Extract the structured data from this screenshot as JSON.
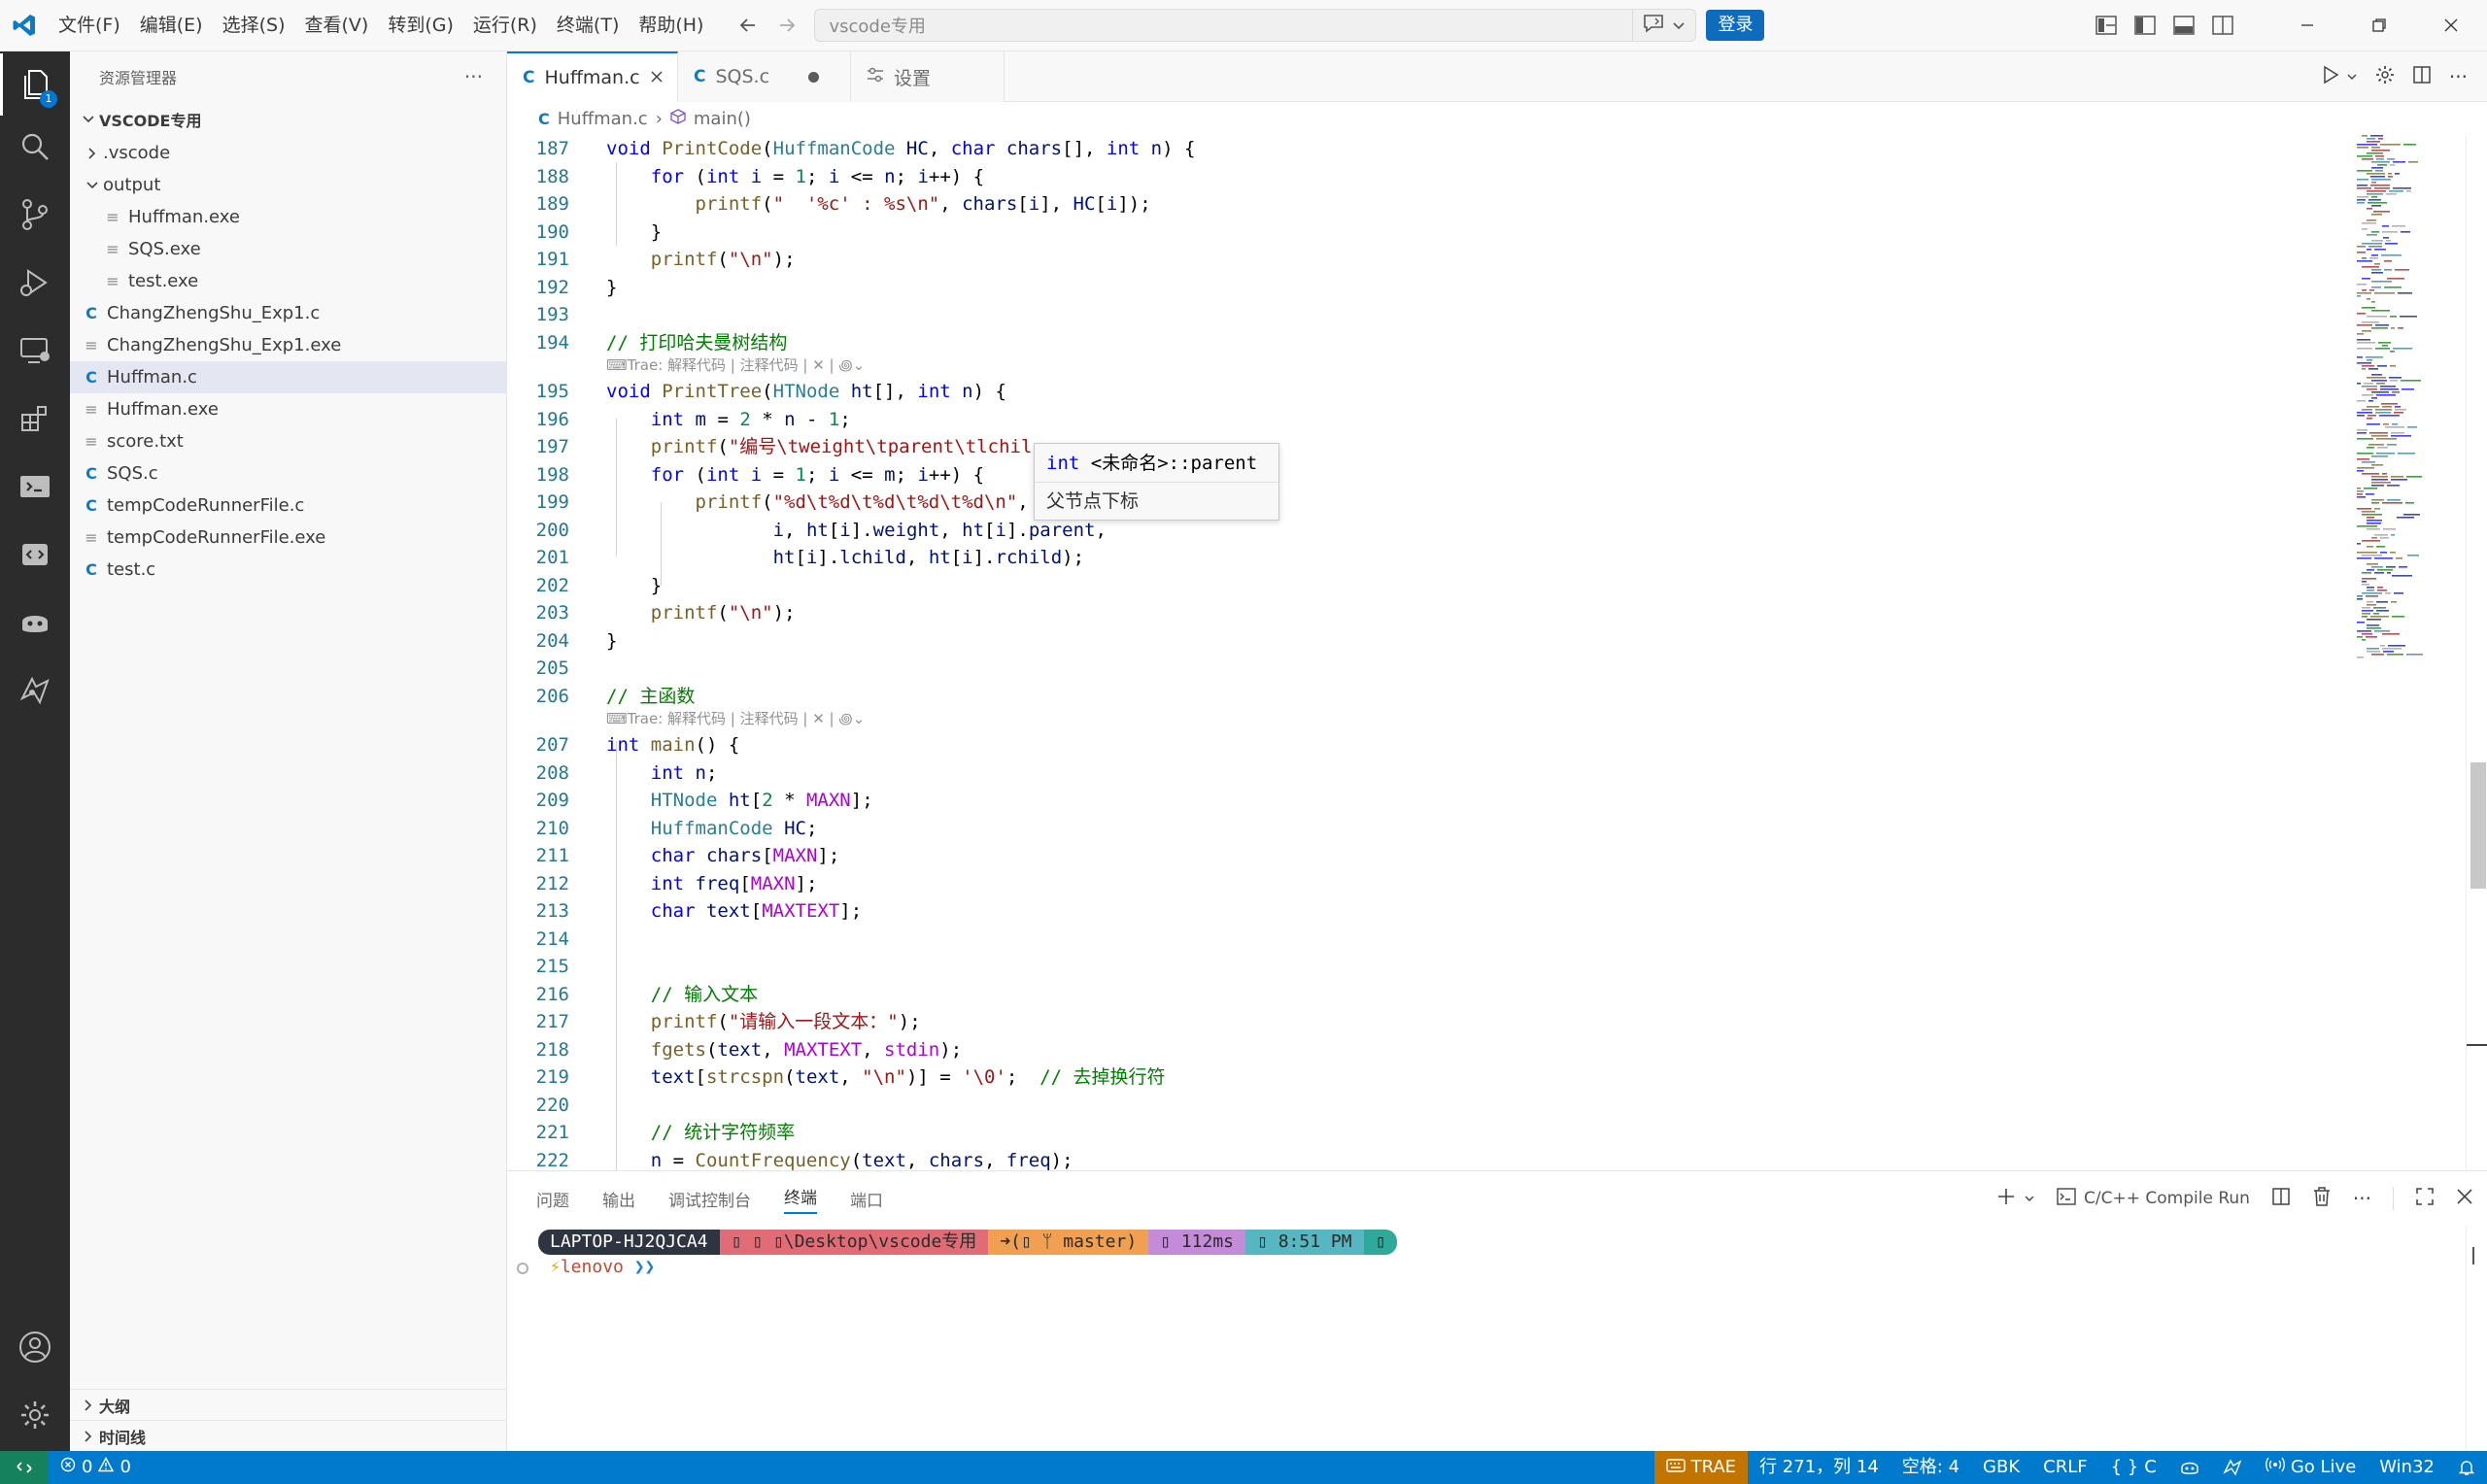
{
  "window": {
    "menu": [
      "文件(F)",
      "编辑(E)",
      "选择(S)",
      "查看(V)",
      "转到(G)",
      "运行(R)",
      "终端(T)",
      "帮助(H)"
    ],
    "search_placeholder": "vscode专用",
    "login_label": "登录"
  },
  "activity": {
    "explorer_badge": "1"
  },
  "sidebar": {
    "header": "资源管理器",
    "folder": "VSCODE专用",
    "items": [
      {
        "label": ".vscode",
        "kind": "folder-collapsed",
        "depth": 0
      },
      {
        "label": "output",
        "kind": "folder-open",
        "depth": 0
      },
      {
        "label": "Huffman.exe",
        "kind": "file",
        "depth": 1
      },
      {
        "label": "SQS.exe",
        "kind": "file",
        "depth": 1
      },
      {
        "label": "test.exe",
        "kind": "file",
        "depth": 1
      },
      {
        "label": "ChangZhengShu_Exp1.c",
        "kind": "c",
        "depth": 0
      },
      {
        "label": "ChangZhengShu_Exp1.exe",
        "kind": "file",
        "depth": 0
      },
      {
        "label": "Huffman.c",
        "kind": "c",
        "depth": 0,
        "selected": true
      },
      {
        "label": "Huffman.exe",
        "kind": "file",
        "depth": 0
      },
      {
        "label": "score.txt",
        "kind": "file",
        "depth": 0
      },
      {
        "label": "SQS.c",
        "kind": "c",
        "depth": 0
      },
      {
        "label": "tempCodeRunnerFile.c",
        "kind": "c",
        "depth": 0
      },
      {
        "label": "tempCodeRunnerFile.exe",
        "kind": "file",
        "depth": 0
      },
      {
        "label": "test.c",
        "kind": "c",
        "depth": 0
      }
    ],
    "outline_label": "大纲",
    "timeline_label": "时间线"
  },
  "tabs": [
    {
      "label": "Huffman.c",
      "icon": "C",
      "active": true
    },
    {
      "label": "SQS.c",
      "icon": "C",
      "modified": true
    },
    {
      "label": "设置",
      "icon": "settings"
    }
  ],
  "breadcrumb": {
    "file": "Huffman.c",
    "symbol": "main()"
  },
  "editor": {
    "codelens": "Trae: 解释代码 | 注释代码 | ✕ |",
    "hover": {
      "signature": "int <未命名>::parent",
      "doc": "父节点下标"
    },
    "lines": [
      {
        "n": "187",
        "html": "<span class='k'>void</span> <span class='f'>PrintCode</span>(<span class='t'>HuffmanCode</span> <span class='p'>HC</span>, <span class='k'>char</span> <span class='p'>chars</span>[], <span class='k'>int</span> <span class='p'>n</span>) {"
      },
      {
        "n": "188",
        "html": "    <span class='k'>for</span> (<span class='k'>int</span> <span class='p'>i</span> = <span class='m'>1</span>; <span class='p'>i</span> &lt;= <span class='p'>n</span>; <span class='p'>i</span>++) {"
      },
      {
        "n": "189",
        "html": "        <span class='f'>printf</span>(<span class='s'>\"  '%c' : %s\\n\"</span>, <span class='p'>chars</span>[<span class='p'>i</span>], <span class='p'>HC</span>[<span class='p'>i</span>]);"
      },
      {
        "n": "190",
        "html": "    }"
      },
      {
        "n": "191",
        "html": "    <span class='f'>printf</span>(<span class='s'>\"\\n\"</span>);"
      },
      {
        "n": "192",
        "html": "}"
      },
      {
        "n": "193",
        "html": ""
      },
      {
        "n": "194",
        "html": "<span class='cm'>// 打印哈夫曼树结构</span>",
        "lens": true
      },
      {
        "n": "195",
        "html": "<span class='k'>void</span> <span class='f'>PrintTree</span>(<span class='t'>HTNode</span> <span class='p'>ht</span>[], <span class='k'>int</span> <span class='p'>n</span>) {"
      },
      {
        "n": "196",
        "html": "    <span class='k'>int</span> <span class='p'>m</span> = <span class='m'>2</span> * <span class='p'>n</span> - <span class='m'>1</span>;"
      },
      {
        "n": "197",
        "html": "    <span class='f'>printf</span>(<span class='s'>\"编号\\tweight\\tparent\\tlchil</span>"
      },
      {
        "n": "198",
        "html": "    <span class='k'>for</span> (<span class='k'>int</span> <span class='p'>i</span> = <span class='m'>1</span>; <span class='p'>i</span> &lt;= <span class='p'>m</span>; <span class='p'>i</span>++) {"
      },
      {
        "n": "199",
        "html": "        <span class='f'>printf</span>(<span class='s'>\"%d\\t%d\\t%d\\t%d\\t%d\\n\"</span>,"
      },
      {
        "n": "200",
        "html": "               <span class='p'>i</span>, <span class='p'>ht</span>[<span class='p'>i</span>].<span class='p'>weight</span>, <span class='p'>ht</span>[<span class='p'>i</span>].<span class='p'>parent</span>,"
      },
      {
        "n": "201",
        "html": "               <span class='p'>ht</span>[<span class='p'>i</span>].<span class='p'>lchild</span>, <span class='p'>ht</span>[<span class='p'>i</span>].<span class='p'>rchild</span>);"
      },
      {
        "n": "202",
        "html": "    }"
      },
      {
        "n": "203",
        "html": "    <span class='f'>printf</span>(<span class='s'>\"\\n\"</span>);"
      },
      {
        "n": "204",
        "html": "}"
      },
      {
        "n": "205",
        "html": ""
      },
      {
        "n": "206",
        "html": "<span class='cm'>// 主函数</span>",
        "lens": true
      },
      {
        "n": "207",
        "html": "<span class='k'>int</span> <span class='f'>main</span>() {"
      },
      {
        "n": "208",
        "html": "    <span class='k'>int</span> <span class='p'>n</span>;"
      },
      {
        "n": "209",
        "html": "    <span class='t'>HTNode</span> <span class='p'>ht</span>[<span class='m'>2</span> * <span class='mac'>MAXN</span>];"
      },
      {
        "n": "210",
        "html": "    <span class='t'>HuffmanCode</span> <span class='p'>HC</span>;"
      },
      {
        "n": "211",
        "html": "    <span class='k'>char</span> <span class='p'>chars</span>[<span class='mac'>MAXN</span>];"
      },
      {
        "n": "212",
        "html": "    <span class='k'>int</span> <span class='p'>freq</span>[<span class='mac'>MAXN</span>];"
      },
      {
        "n": "213",
        "html": "    <span class='k'>char</span> <span class='p'>text</span>[<span class='mac'>MAXTEXT</span>];"
      },
      {
        "n": "214",
        "html": ""
      },
      {
        "n": "215",
        "html": ""
      },
      {
        "n": "216",
        "html": "    <span class='cm'>// 输入文本</span>"
      },
      {
        "n": "217",
        "html": "    <span class='f'>printf</span>(<span class='s'>\"请输入一段文本：\"</span>);"
      },
      {
        "n": "218",
        "html": "    <span class='f'>fgets</span>(<span class='p'>text</span>, <span class='mac'>MAXTEXT</span>, <span class='mac'>stdin</span>);"
      },
      {
        "n": "219",
        "html": "    <span class='p'>text</span>[<span class='f'>strcspn</span>(<span class='p'>text</span>, <span class='s'>\"\\n\"</span>)] = <span class='s'>'\\0'</span>;  <span class='cm'>// 去掉换行符</span>"
      },
      {
        "n": "220",
        "html": ""
      },
      {
        "n": "221",
        "html": "    <span class='cm'>// 统计字符频率</span>"
      },
      {
        "n": "222",
        "html": "    <span class='p'>n</span> = <span class='f'>CountFrequency</span>(<span class='p'>text</span>, <span class='p'>chars</span>, <span class='p'>freq</span>);"
      }
    ]
  },
  "panel": {
    "tabs": [
      "问题",
      "输出",
      "调试控制台",
      "终端",
      "端口"
    ],
    "active_tab": "终端",
    "run_label": "C/C++ Compile Run",
    "prompt_segments": [
      {
        "text": " LAPTOP-HJ2QJCA4 ",
        "bg": "#2e3440",
        "fg": "#ffffff"
      },
      {
        "text": "▯ ▯ ▯\\Desktop\\vscode专用 ",
        "bg": "#e06c75",
        "fg": "#2b2b2b"
      },
      {
        "text": "➜(▯ ᛘ master) ",
        "bg": "#f0a050",
        "fg": "#2b2b2b"
      },
      {
        "text": "▯ 112ms ",
        "bg": "#c48cd8",
        "fg": "#2b2b2b"
      },
      {
        "text": "▯ 8:51 PM ",
        "bg": "#56b6c2",
        "fg": "#2b2b2b"
      },
      {
        "text": "▯",
        "bg": "#2ea99a",
        "fg": "#2b2b2b"
      }
    ],
    "prompt_user": "lenovo",
    "prompt_arrows": "❯❯"
  },
  "status": {
    "errors": "0",
    "warnings": "0",
    "trae": "TRAE",
    "position": "行 271，列 14",
    "spaces": "空格: 4",
    "encoding": "GBK",
    "eol": "CRLF",
    "language": "C",
    "golive": "Go Live",
    "platform": "Win32"
  }
}
